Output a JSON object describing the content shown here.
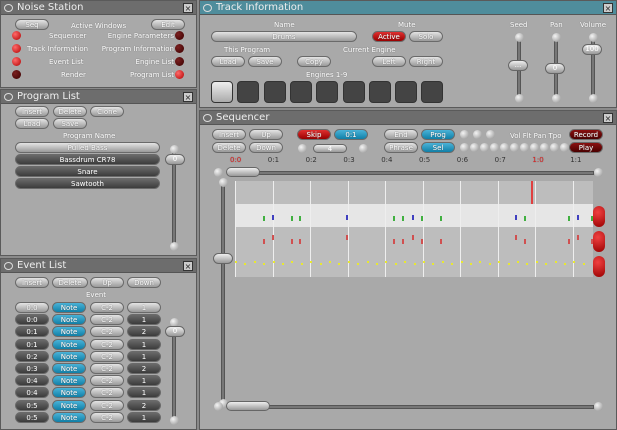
{
  "noise_station": {
    "title": "Noise Station",
    "seq": "Seq",
    "active_windows": "Active Windows",
    "edit": "Edit",
    "windows": [
      {
        "left": "Sequencer",
        "left_on": true,
        "right": "Engine Parameters",
        "right_on": false
      },
      {
        "left": "Track Information",
        "left_on": true,
        "right": "Program Information",
        "right_on": false
      },
      {
        "left": "Event List",
        "left_on": true,
        "right": "Engine List",
        "right_on": false
      },
      {
        "left": "Render",
        "left_on": false,
        "right": "Program List",
        "right_on": true
      }
    ]
  },
  "program_list": {
    "title": "Program List",
    "insert": "Insert",
    "delete": "Delete",
    "clone": "Clone",
    "load": "Load",
    "save": "Save",
    "header": "Program Name",
    "items": [
      "Pulled Bass",
      "Bassdrum CR78",
      "Snare",
      "Sawtooth"
    ],
    "selected": 0,
    "scroll_value": "0"
  },
  "event_list": {
    "title": "Event List",
    "insert": "Insert",
    "delete": "Delete",
    "up": "Up",
    "down": "Down",
    "header": "Event",
    "scroll_value": "0",
    "rows": [
      [
        "0:0",
        "Note",
        "C-2",
        "1"
      ],
      [
        "0:0",
        "Note",
        "C-2",
        "1"
      ],
      [
        "0:1",
        "Note",
        "C-2",
        "2"
      ],
      [
        "0:1",
        "Note",
        "C-2",
        "1"
      ],
      [
        "0:2",
        "Note",
        "C-2",
        "1"
      ],
      [
        "0:3",
        "Note",
        "C-2",
        "2"
      ],
      [
        "0:4",
        "Note",
        "C-2",
        "1"
      ],
      [
        "0:4",
        "Note",
        "C-2",
        "1"
      ],
      [
        "0:5",
        "Note",
        "C-2",
        "2"
      ],
      [
        "0:5",
        "Note",
        "C-2",
        "1"
      ]
    ]
  },
  "track_info": {
    "title": "Track Information",
    "name_label": "Name",
    "name": "Drums",
    "mute_label": "Mute",
    "active": "Active",
    "solo": "Solo",
    "this_program": "This Program",
    "load": "Load",
    "save": "Save",
    "copy": "Copy",
    "current_engine": "Current Engine",
    "left": "Left",
    "right": "Right",
    "engines_label": "Engines 1-9",
    "active_engine": 1,
    "seed_label": "Seed",
    "seed": "...",
    "pan_label": "Pan",
    "pan": "0",
    "volume_label": "Volume",
    "volume": "100"
  },
  "sequencer": {
    "title": "Sequencer",
    "insert": "Insert",
    "up": "Up",
    "delete": "Delete",
    "down": "Down",
    "skip": "Skip",
    "step": "0:1",
    "quant": "4",
    "end": "End",
    "prog": "Prog",
    "phrase": "Phrase",
    "sel": "Sel",
    "cols": "Vol Flt Pan Tpo",
    "record": "Record",
    "play": "Play",
    "ruler": [
      "0:0",
      "0:1",
      "0:2",
      "0:3",
      "0:4",
      "0:5",
      "0:6",
      "0:7",
      "1:0",
      "1:1"
    ],
    "ruler_red": [
      "0:0",
      "1:0"
    ]
  },
  "colors": {
    "led_on": "#e02020",
    "blue": "#1a90b8",
    "red": "#c81818",
    "title_teal": "#4f8d9c"
  }
}
